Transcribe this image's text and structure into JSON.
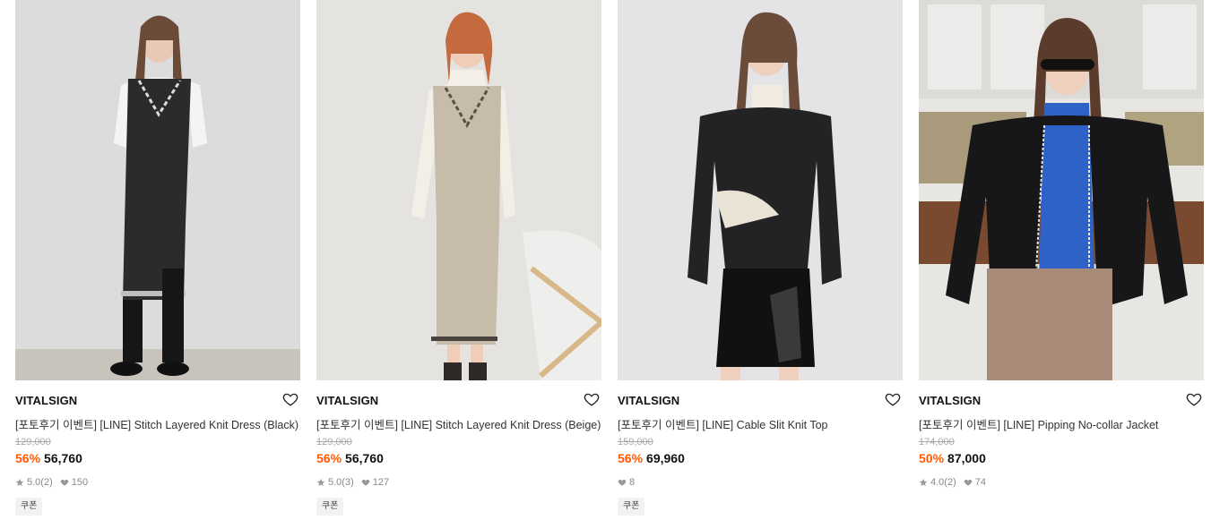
{
  "colors": {
    "discount": "#ff5a00",
    "text": "#111111",
    "muted": "#888888"
  },
  "icons": {
    "wishlist": "heart-outline-icon",
    "rating": "star-icon",
    "likes": "heart-filled-icon"
  },
  "products": [
    {
      "brand": "VITALSIGN",
      "name": "[포토후기 이벤트] [LINE] Stitch Layered Knit Dress (Black)",
      "original_price": "129,000",
      "discount": "56%",
      "price": "56,760",
      "rating": "5.0",
      "review_count": "(2)",
      "likes": "150",
      "coupon": "쿠폰"
    },
    {
      "brand": "VITALSIGN",
      "name": "[포토후기 이벤트] [LINE] Stitch Layered Knit Dress (Beige)",
      "original_price": "129,000",
      "discount": "56%",
      "price": "56,760",
      "rating": "5.0",
      "review_count": "(3)",
      "likes": "127",
      "coupon": "쿠폰"
    },
    {
      "brand": "VITALSIGN",
      "name": "[포토후기 이벤트] [LINE] Cable Slit Knit Top",
      "original_price": "159,000",
      "discount": "56%",
      "price": "69,960",
      "likes": "8",
      "coupon": "쿠폰"
    },
    {
      "brand": "VITALSIGN",
      "name": "[포토후기 이벤트] [LINE] Pipping No-collar Jacket",
      "original_price": "174,000",
      "discount": "50%",
      "price": "87,000",
      "rating": "4.0",
      "review_count": "(2)",
      "likes": "74"
    }
  ]
}
